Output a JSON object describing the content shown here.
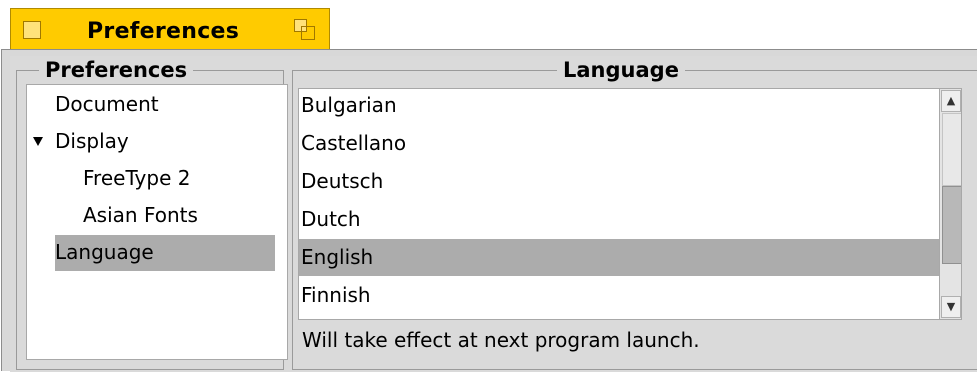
{
  "window": {
    "title": "Preferences"
  },
  "left_panel": {
    "title": "Preferences",
    "items": [
      {
        "label": "Document",
        "indent": 0,
        "expanded": false,
        "selected": false
      },
      {
        "label": "Display",
        "indent": 0,
        "expanded": true,
        "selected": false
      },
      {
        "label": "FreeType 2",
        "indent": 1,
        "expanded": false,
        "selected": false
      },
      {
        "label": "Asian Fonts",
        "indent": 1,
        "expanded": false,
        "selected": false
      },
      {
        "label": "Language",
        "indent": 0,
        "expanded": false,
        "selected": true
      }
    ]
  },
  "right_panel": {
    "title": "Language",
    "languages": [
      {
        "label": "Bulgarian",
        "selected": false
      },
      {
        "label": "Castellano",
        "selected": false
      },
      {
        "label": "Deutsch",
        "selected": false
      },
      {
        "label": "Dutch",
        "selected": false
      },
      {
        "label": "English",
        "selected": true
      },
      {
        "label": "Finnish",
        "selected": false
      }
    ],
    "scroll_fraction": 0.4,
    "note": "Will take effect at next program launch."
  },
  "colors": {
    "tab_yellow": "#ffcb00",
    "selection_gray": "#acacac",
    "panel_gray": "#dadada"
  },
  "icons": {
    "close": "close-box-icon",
    "zoom": "zoom-box-icon",
    "expand": "disclosure-triangle-icon",
    "scroll_up": "scroll-up-arrow-icon",
    "scroll_down": "scroll-down-arrow-icon"
  }
}
